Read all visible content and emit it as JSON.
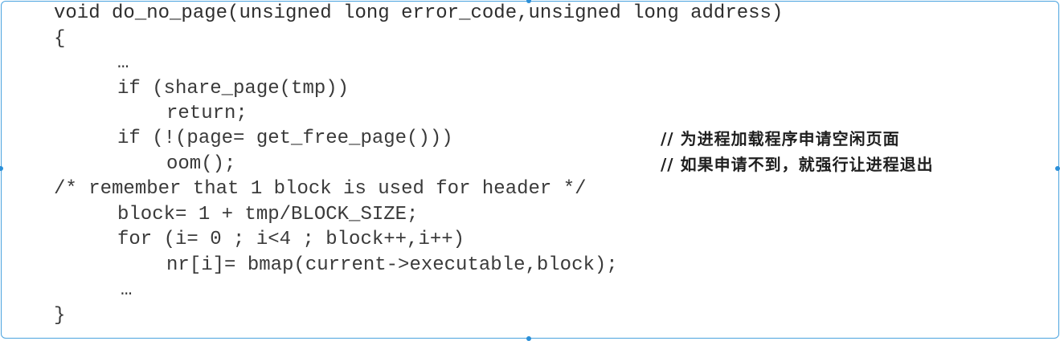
{
  "code": {
    "lines": [
      "void do_no_page(unsigned long error_code,unsigned long address)",
      "{",
      "…",
      "if (share_page(tmp))",
      "return;",
      "if (!(page= get_free_page()))",
      "oom();",
      "/* remember that 1 block is used for header */",
      "block= 1 + tmp/BLOCK_SIZE;",
      "for (i= 0 ; i<4 ; block++,i++)",
      "nr[i]= bmap(current->executable,block);",
      "…",
      "}"
    ],
    "comments": [
      "// 为进程加载程序申请空闲页面",
      "// 如果申请不到，就强行让进程退出"
    ]
  }
}
